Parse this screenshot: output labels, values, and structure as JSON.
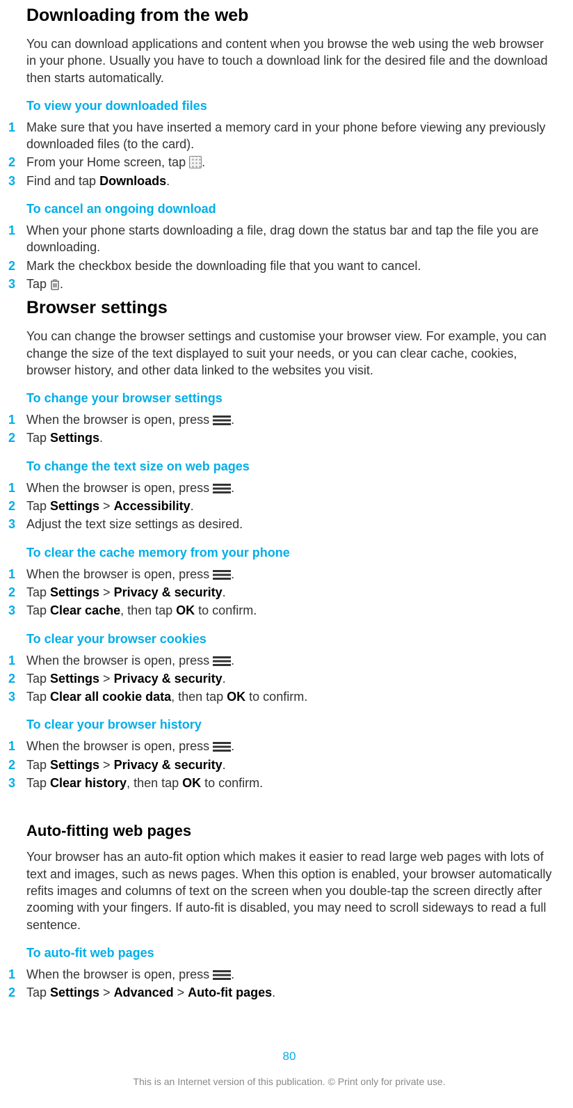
{
  "sec1": {
    "title": "Downloading from the web",
    "body": "You can download applications and content when you browse the web using the web browser in your phone. Usually you have to touch a download link for the desired file and the download then starts automatically.",
    "sub1": {
      "title": "To view your downloaded files",
      "s1": "Make sure that you have inserted a memory card in your phone before viewing any previously downloaded files (to the card).",
      "s2a": "From your Home screen, tap ",
      "s2b": ".",
      "s3a": "Find and tap ",
      "s3b": "Downloads",
      "s3c": "."
    },
    "sub2": {
      "title": "To cancel an ongoing download",
      "s1": "When your phone starts downloading a file, drag down the status bar and tap the file you are downloading.",
      "s2": "Mark the checkbox beside the downloading file that you want to cancel.",
      "s3a": "Tap ",
      "s3b": "."
    }
  },
  "sec2": {
    "title": "Browser settings",
    "body": "You can change the browser settings and customise your browser view. For example, you can change the size of the text displayed to suit your needs, or you can clear cache, cookies, browser history, and other data linked to the websites you visit.",
    "sub1": {
      "title": "To change your browser settings",
      "s1a": "When the browser is open, press ",
      "s1b": ".",
      "s2a": "Tap ",
      "s2b": "Settings",
      "s2c": "."
    },
    "sub2": {
      "title": "To change the text size on web pages",
      "s1a": "When the browser is open, press ",
      "s1b": ".",
      "s2a": "Tap ",
      "s2b": "Settings",
      "s2c": " > ",
      "s2d": "Accessibility",
      "s2e": ".",
      "s3": "Adjust the text size settings as desired."
    },
    "sub3": {
      "title": "To clear the cache memory from your phone",
      "s1a": "When the browser is open, press ",
      "s1b": ".",
      "s2a": "Tap ",
      "s2b": "Settings",
      "s2c": " > ",
      "s2d": "Privacy & security",
      "s2e": ".",
      "s3a": "Tap ",
      "s3b": "Clear cache",
      "s3c": ", then tap ",
      "s3d": "OK",
      "s3e": " to confirm."
    },
    "sub4": {
      "title": "To clear your browser cookies",
      "s1a": "When the browser is open, press ",
      "s1b": ".",
      "s2a": "Tap ",
      "s2b": "Settings",
      "s2c": " > ",
      "s2d": "Privacy & security",
      "s2e": ".",
      "s3a": "Tap ",
      "s3b": "Clear all cookie data",
      "s3c": ", then tap ",
      "s3d": "OK",
      "s3e": " to confirm."
    },
    "sub5": {
      "title": "To clear your browser history",
      "s1a": "When the browser is open, press ",
      "s1b": ".",
      "s2a": "Tap ",
      "s2b": "Settings",
      "s2c": " > ",
      "s2d": "Privacy & security",
      "s2e": ".",
      "s3a": "Tap ",
      "s3b": "Clear history",
      "s3c": ", then tap ",
      "s3d": "OK",
      "s3e": " to confirm."
    }
  },
  "sec3": {
    "title": "Auto-fitting web pages",
    "body": "Your browser has an auto-fit option which makes it easier to read large web pages with lots of text and images, such as news pages. When this option is enabled, your browser automatically refits images and columns of text on the screen when you double-tap the screen directly after zooming with your fingers. If auto-fit is disabled, you may need to scroll sideways to read a full sentence.",
    "sub1": {
      "title": "To auto-fit web pages",
      "s1a": "When the browser is open, press ",
      "s1b": ".",
      "s2a": "Tap ",
      "s2b": "Settings",
      "s2c": " > ",
      "s2d": "Advanced",
      "s2e": " > ",
      "s2f": "Auto-fit pages",
      "s2g": "."
    }
  },
  "footer": {
    "page": "80",
    "copyright": "This is an Internet version of this publication. © Print only for private use."
  },
  "nums": {
    "n1": "1",
    "n2": "2",
    "n3": "3"
  }
}
